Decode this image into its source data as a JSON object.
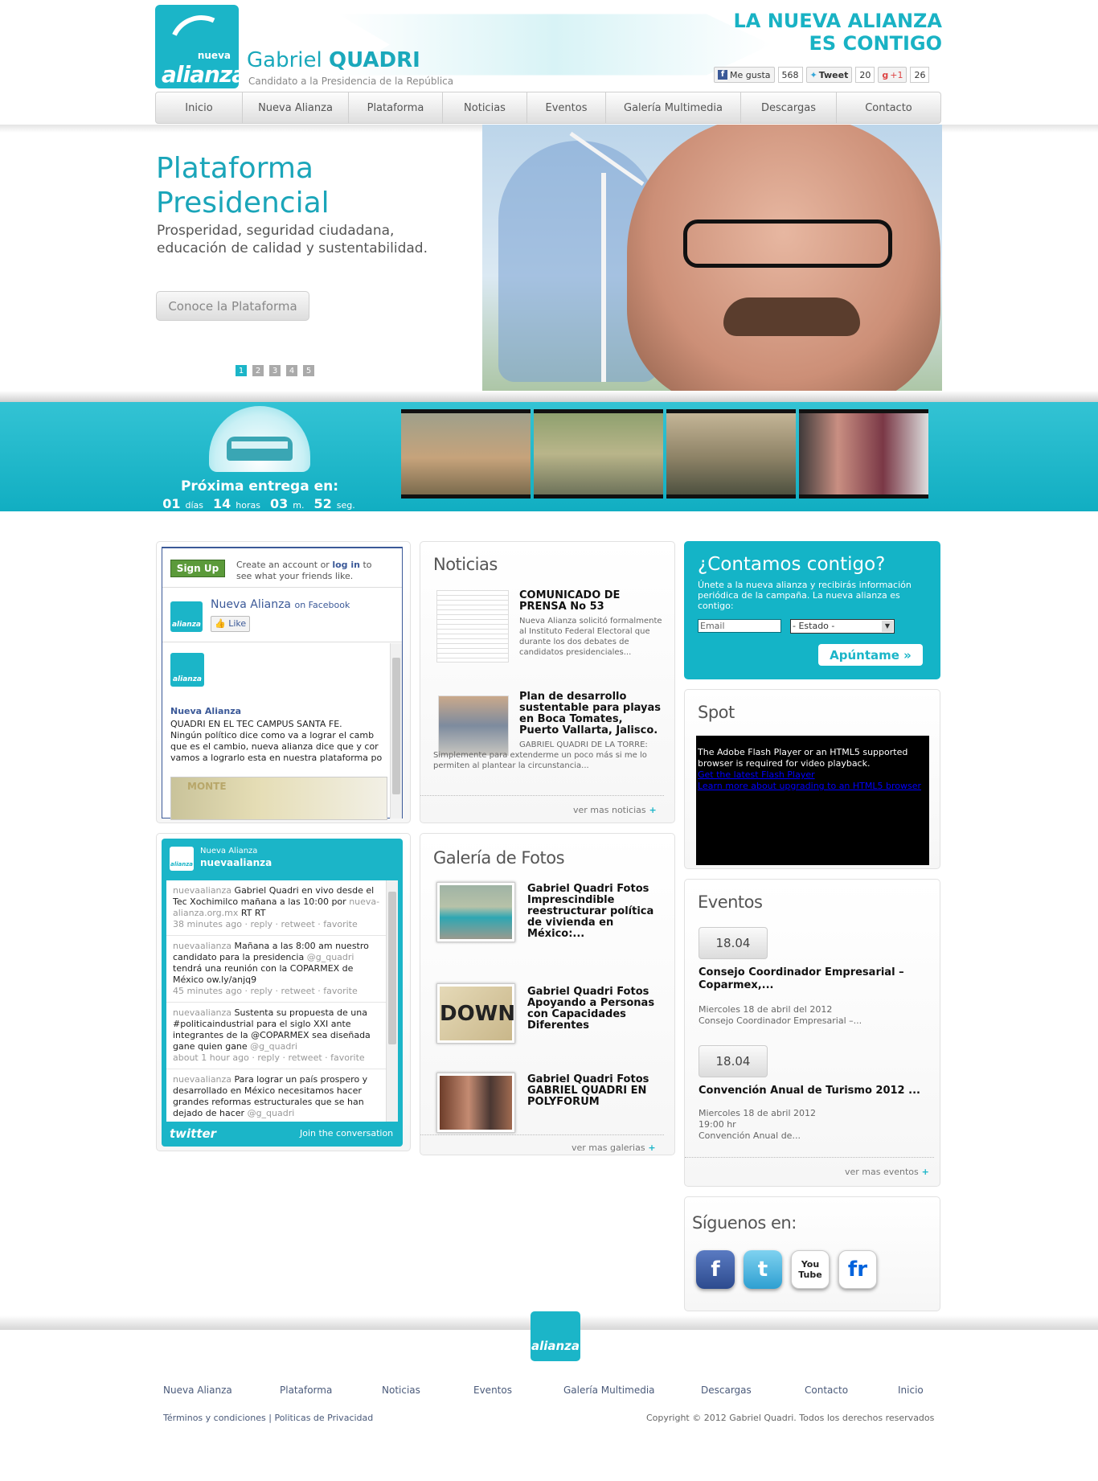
{
  "header": {
    "logo_top": "nueva",
    "logo_main": "alianza",
    "candidate_first": "Gabriel",
    "candidate_last": "QUADRI",
    "candidate_sub": "Candidato a la Presidencia de la República",
    "slogan_line1": "LA NUEVA ALIANZA",
    "slogan_line2": "ES CONTIGO",
    "social": {
      "like_label": "Me gusta",
      "like_count": "568",
      "tweet_label": "Tweet",
      "tweet_count": "20",
      "gplus_label": "+1",
      "gplus_count": "26"
    }
  },
  "nav": [
    "Inicio",
    "Nueva Alianza",
    "Plataforma",
    "Noticias",
    "Eventos",
    "Galería Multimedia",
    "Descargas",
    "Contacto"
  ],
  "hero": {
    "title_line1": "Plataforma",
    "title_line2": "Presidencial",
    "subtitle_line1": "Prosperidad, seguridad ciudadana,",
    "subtitle_line2": "educación de calidad y sustentabilidad.",
    "button": "Conoce la Plataforma",
    "pages": [
      "1",
      "2",
      "3",
      "4",
      "5"
    ],
    "active_page": "1"
  },
  "band": {
    "next_label": "Próxima entrega en:",
    "days": "01",
    "days_unit": "días",
    "hours": "14",
    "hours_unit": "horas",
    "minutes": "03",
    "minutes_unit": "m.",
    "seconds": "52",
    "seconds_unit": "seg."
  },
  "facebook": {
    "signup": "Sign Up",
    "create_text_1": "Create an account or",
    "login": "log in",
    "create_text_2": "to",
    "create_text_3": "see what your friends like.",
    "page_name": "Nueva Alianza",
    "on_facebook": "on Facebook",
    "like": "Like",
    "post_author": "Nueva Alianza",
    "post_line1": "QUADRI EN EL TEC CAMPUS SANTA FE.",
    "post_line2": "Ningún político dice como va a lograr el camb",
    "post_line3": "que es el cambio, nueva alianza dice que y cor",
    "post_line4": "vamos a lograrlo esta en nuestra plataforma po",
    "photo_text": "MONTE"
  },
  "twitter": {
    "header_name": "Nueva Alianza",
    "header_handle": "nuevaalianza",
    "tweets": [
      {
        "user": "nuevaalianza",
        "text": "Gabriel Quadri en vivo desde el Tec Xochimilco mañana a las 10:00 por",
        "link": "nueva-alianza.org.mx",
        "tail": "RT RT",
        "meta": "38 minutes ago · reply · retweet · favorite"
      },
      {
        "user": "nuevaalianza",
        "text": "Mañana a las 8:00 am nuestro candidato para la presidencia",
        "link": "@g_quadri",
        "tail": "tendrá una reunión con la COPARMEX de México ow.ly/anjq9",
        "meta": "45 minutes ago · reply · retweet · favorite"
      },
      {
        "user": "nuevaalianza",
        "text": "Sustenta su propuesta de una #politicaindustrial para el siglo XXI ante integrantes de la @COPARMEX sea diseñada gane quien gane",
        "link": "@g_quadri",
        "tail": "",
        "meta": "about 1 hour ago · reply · retweet · favorite"
      },
      {
        "user": "nuevaalianza",
        "text": "Para lograr un país prospero y desarrollado en México necesitamos hacer grandes reformas estructurales que se han dejado de hacer",
        "link": "@g_quadri",
        "tail": "",
        "meta": ""
      }
    ],
    "footer_logo": "twitter",
    "join": "Join the conversation"
  },
  "news": {
    "title": "Noticias",
    "items": [
      {
        "title": "COMUNICADO DE PRENSA No 53",
        "text": "Nueva Alianza solicitó formalmente al Instituto Federal Electoral que durante los dos debates de candidatos presidenciales..."
      },
      {
        "title": "Plan de desarrollo sustentable para playas en Boca Tomates, Puerto Vallarta, Jalisco.",
        "text": "GABRIEL QUADRI DE LA TORRE: Simplemente para extenderme un poco más si me lo permiten al plantear la circunstancia..."
      }
    ],
    "more": "ver mas noticias"
  },
  "gallery": {
    "title": "Galería de Fotos",
    "items": [
      {
        "title": "Gabriel Quadri Fotos Imprescindible reestructurar política de vivienda en México:..."
      },
      {
        "title": "Gabriel Quadri Fotos Apoyando a Personas con Capacidades Diferentes"
      },
      {
        "title": "Gabriel Quadri Fotos GABRIEL QUADRI EN POLYFORUM"
      }
    ],
    "photo_text": "DOWN",
    "more": "ver mas galerias"
  },
  "subscribe": {
    "title": "¿Contamos contigo?",
    "text": "Únete a la nueva alianza y recibirás información periódica de la campaña. La nueva alianza es contigo:",
    "email_placeholder": "Email",
    "state_selected": "- Estado -",
    "button": "Apúntame »"
  },
  "spot": {
    "title": "Spot",
    "msg1": "The Adobe Flash Player or an HTML5 supported browser is required for video playback.",
    "link1": "Get the latest Flash Player",
    "link2": "Learn more about upgrading to an HTML5 browser"
  },
  "events": {
    "title": "Eventos",
    "items": [
      {
        "date": "18.04",
        "title": "Consejo Coordinador Empresarial – Coparmex,...",
        "line1": "Miercoles 18 de abril del 2012",
        "line2": "Consejo Coordinador Empresarial –...",
        "line3": ""
      },
      {
        "date": "18.04",
        "title": "Convención Anual de Turismo 2012 ...",
        "line1": "Miercoles 18 de abril 2012",
        "line2": "19:00 hr",
        "line3": "Convención Anual de..."
      }
    ],
    "more": "ver mas eventos"
  },
  "follow": {
    "title": "Síguenos en:",
    "networks": [
      "facebook",
      "twitter",
      "youtube",
      "flickr"
    ],
    "youtube_label": "You Tube",
    "flickr_label": "fr"
  },
  "footer": {
    "logo_top": "nueva",
    "logo_main": "alianza",
    "links": [
      "Nueva Alianza",
      "Plataforma",
      "Noticias",
      "Eventos",
      "Galería Multimedia",
      "Descargas",
      "Contacto",
      "Inicio"
    ],
    "terms": "Términos y condiciones",
    "privacy": "Politicas de Privacidad",
    "copyright": "Copyright © 2012 Gabriel Quadri. Todos los derechos reservados"
  },
  "colors": {
    "accent": "#1bb5c8",
    "text": "#333333"
  }
}
